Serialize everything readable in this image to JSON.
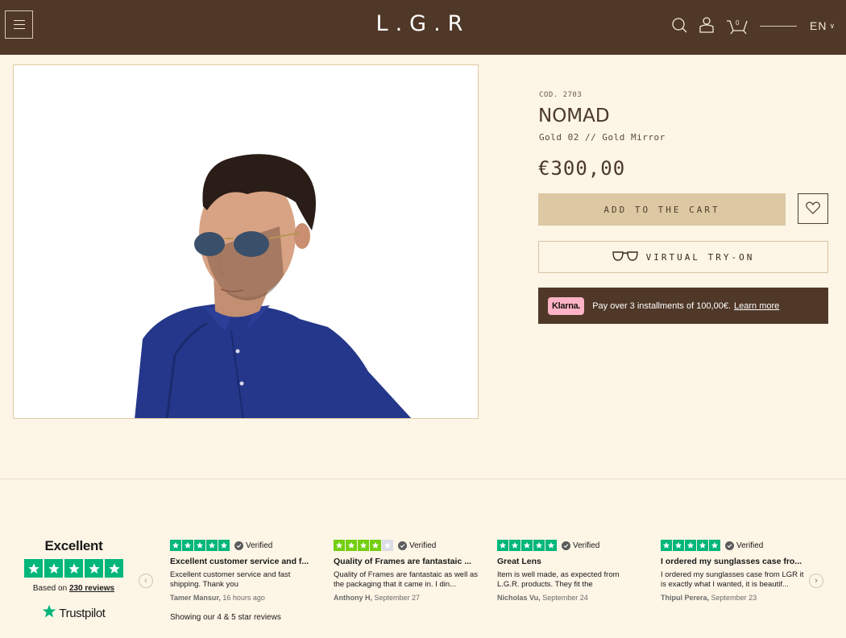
{
  "header": {
    "logo": "L.G.R",
    "cart_count": "0",
    "language": "EN"
  },
  "product": {
    "code": "COD. 2703",
    "name": "NOMAD",
    "variant": "Gold 02 // Gold Mirror",
    "price": "€300,00",
    "add_to_cart": "ADD TO THE CART",
    "virtual_try_on": "VIRTUAL TRY-ON",
    "image_alt": "Man wearing gold aviator sunglasses in blue shirt"
  },
  "klarna": {
    "badge": "Klarna.",
    "text": "Pay over 3 installments of 100,00€.",
    "link": "Learn more"
  },
  "trustpilot": {
    "rating_label": "Excellent",
    "based_on": "Based on",
    "reviews_link": "230 reviews",
    "brand": "Trustpilot",
    "showing": "Showing our 4 & 5 star reviews",
    "verified_label": "Verified"
  },
  "reviews": [
    {
      "stars": 5,
      "title": "Excellent customer service and f...",
      "body": "Excellent customer service and fast shipping. Thank you",
      "author": "Tamer Mansur,",
      "date": "16 hours ago"
    },
    {
      "stars": 4,
      "title": "Quality of Frames are fantastaic ...",
      "body": "Quality of Frames are fantastaic as well as the packaging that it came in. I din...",
      "author": "Anthony H,",
      "date": "September 27"
    },
    {
      "stars": 5,
      "title": "Great Lens",
      "body": "Item is well made, as expected from L.G.R. products. They fit the",
      "author": "Nicholas Vu,",
      "date": "September 24"
    },
    {
      "stars": 5,
      "title": "I ordered my sunglasses case fro...",
      "body": "I ordered my sunglasses case from LGR it is exactly what I wanted, it is beautif...",
      "author": "Thipul Perera,",
      "date": "September 23"
    }
  ],
  "colors": {
    "header_bg": "#4f3828",
    "page_bg": "#fdf5e6",
    "cart_button": "#dcc8a2",
    "trustpilot_green": "#00b67a",
    "four_star_green": "#73cf11",
    "klarna_pink": "#ffb3c7"
  },
  "icons": {
    "menu": "hamburger-icon",
    "search": "search-icon",
    "account": "user-icon",
    "cart": "cart-icon",
    "wishlist": "heart-icon",
    "try_on": "glasses-icon",
    "verified": "check-circle-icon",
    "prev": "chevron-left-icon",
    "next": "chevron-right-icon"
  }
}
